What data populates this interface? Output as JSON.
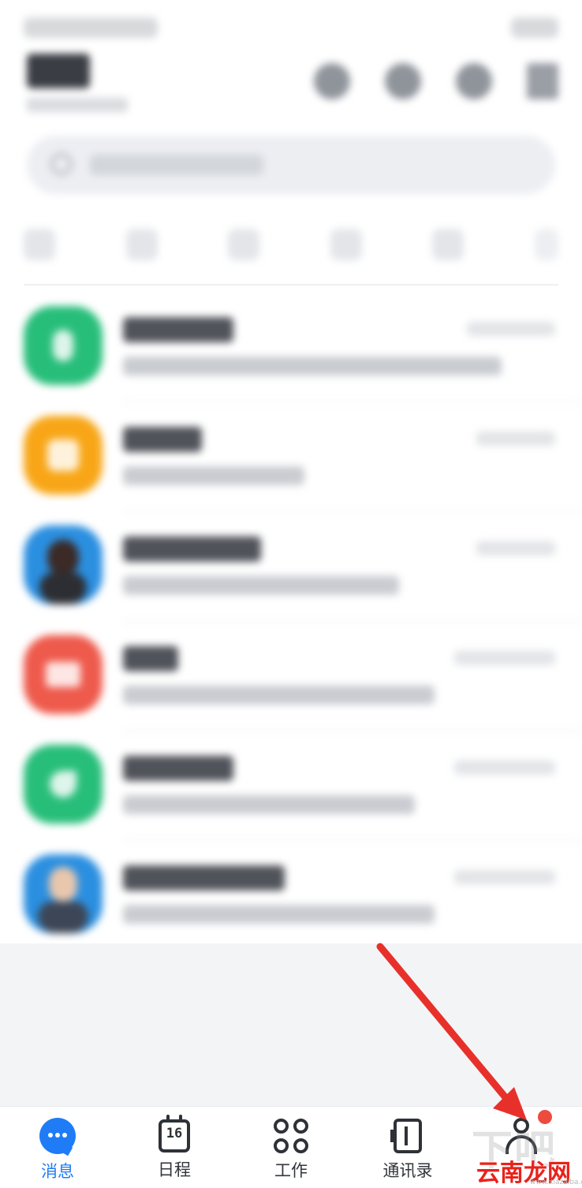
{
  "colors": {
    "accent": "#1f7cf6",
    "badge": "#ee4b3f",
    "arrow": "#e8302b"
  },
  "search": {
    "placeholder": ""
  },
  "conversations": [
    {
      "avatar_color": "#27be7a",
      "avatar_icon": "bulb-icon"
    },
    {
      "avatar_color": "#f8a617",
      "avatar_icon": "gift-icon"
    },
    {
      "avatar_color": "#2b8fe0",
      "avatar_icon": "person-photo"
    },
    {
      "avatar_color": "#ee5a4c",
      "avatar_icon": "envelope-icon"
    },
    {
      "avatar_color": "#27be7a",
      "avatar_icon": "phone-icon"
    },
    {
      "avatar_color": "#2b8fe0",
      "avatar_icon": "person-photo"
    }
  ],
  "tabbar": {
    "tabs": [
      {
        "label": "消息",
        "icon": "message-bubble-icon",
        "active": true
      },
      {
        "label": "日程",
        "icon": "calendar-icon",
        "calendar_day": "16",
        "active": false
      },
      {
        "label": "工作",
        "icon": "grid-apps-icon",
        "active": false
      },
      {
        "label": "通讯录",
        "icon": "contacts-book-icon",
        "active": false
      },
      {
        "label": "",
        "icon": "profile-icon",
        "active": false,
        "has_badge": true
      }
    ]
  },
  "watermark": {
    "logo": "云南龙网",
    "url": "www.xiazaiba.com"
  }
}
